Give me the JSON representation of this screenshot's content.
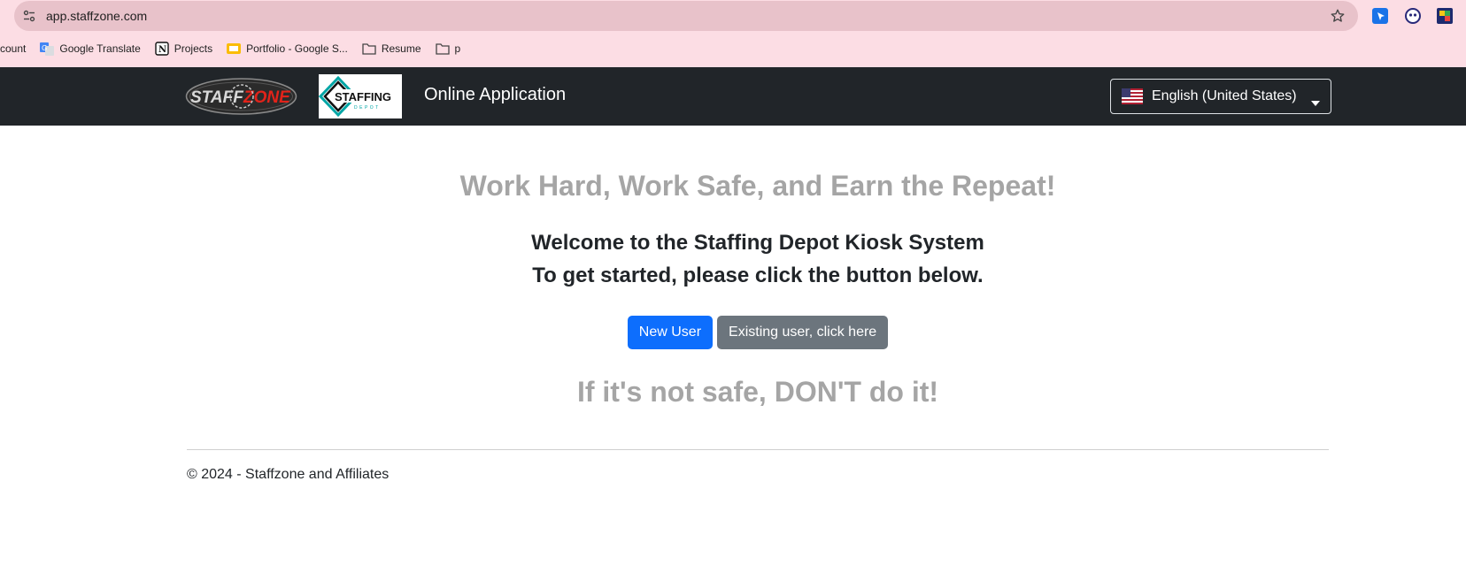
{
  "browser": {
    "url": "app.staffzone.com",
    "bookmarks": [
      {
        "label": "count",
        "icon": "none"
      },
      {
        "label": "Google Translate",
        "icon": "google-translate-icon"
      },
      {
        "label": "Projects",
        "icon": "notion-icon"
      },
      {
        "label": "Portfolio - Google S...",
        "icon": "google-slides-icon"
      },
      {
        "label": "Resume",
        "icon": "folder-icon"
      },
      {
        "label": "p",
        "icon": "folder-icon"
      }
    ],
    "extensions": [
      "cursor-extension-icon",
      "ghost-extension-icon",
      "puzzle-extension-icon"
    ]
  },
  "header": {
    "title": "Online Application",
    "language": "English (United States)",
    "logos": [
      "staffzone-logo",
      "staffing-depot-logo"
    ]
  },
  "main": {
    "tagline": "Work Hard, Work Safe, and Earn the Repeat!",
    "welcome": "Welcome to the Staffing Depot Kiosk System",
    "instruction": "To get started, please click the button below.",
    "new_user_button": "New User",
    "existing_user_button": "Existing user, click here",
    "safety_message": "If it's not safe, DON'T do it!"
  },
  "footer": {
    "copyright": "© 2024 - Staffzone and Affiliates"
  },
  "colors": {
    "header_bg": "#212529",
    "primary": "#0d6efd",
    "secondary": "#6c757d",
    "muted_heading": "#a5a5a5",
    "chrome_bg": "#fcdde4"
  }
}
